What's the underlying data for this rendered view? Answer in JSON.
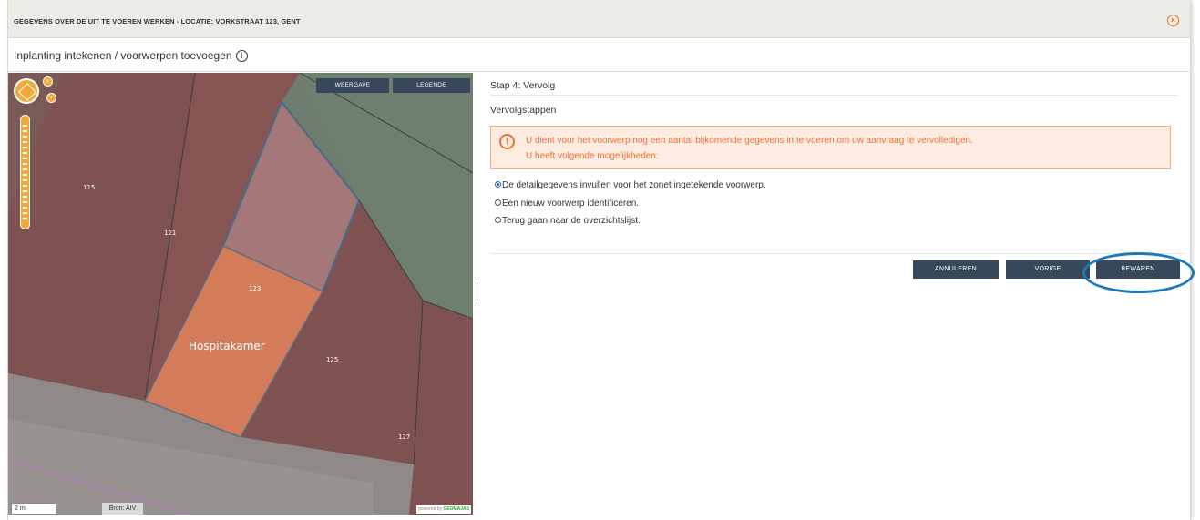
{
  "window": {
    "title": "GEGEVENS OVER DE UIT TE VOEREN WERKEN - LOCATIE: VORKSTRAAT 123, GENT",
    "close_icon": "close-circle-icon"
  },
  "subheader": {
    "title": "Inplanting intekenen / voorwerpen toevoegen",
    "info_icon": "info-icon"
  },
  "map": {
    "buttons": {
      "weergave": "WEERGAVE",
      "legende": "LEGENDE"
    },
    "parcel_labels": [
      "115",
      "121",
      "123",
      "125",
      "127"
    ],
    "object_label": "Hospitakamer",
    "scale": "2 m",
    "source": "Bron: AIV",
    "powered_by": "powered by",
    "powered_brand": "GEOMAJAS"
  },
  "panel": {
    "step_title": "Stap 4: Vervolg",
    "section_title": "Vervolgstappen",
    "alert": {
      "line1": "U dient voor het voorwerp nog een aantal bijkomende gegevens in te voeren om uw aanvraag te vervolledigen.",
      "line2": "U heeft volgende mogelijkheden:",
      "color": "#e8733a"
    },
    "options": [
      {
        "label": "De detailgegevens invullen voor het zonet ingetekende voorwerp.",
        "selected": true
      },
      {
        "label": "Een nieuw voorwerp identificeren.",
        "selected": false
      },
      {
        "label": "Terug gaan naar de overzichtslijst.",
        "selected": false
      }
    ],
    "buttons": {
      "annuleren": "ANNULEREN",
      "vorige": "VORIGE",
      "bewaren": "BEWAREN"
    }
  },
  "colors": {
    "accent_orange": "#e8733a",
    "button_dark": "#36485a",
    "highlight_ring": "#1d7ab8"
  }
}
